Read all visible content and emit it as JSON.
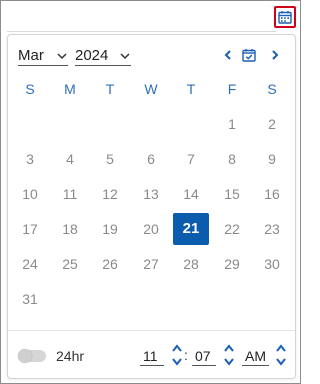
{
  "picker": {
    "month": "Mar",
    "year": "2024",
    "weekdays": [
      "S",
      "M",
      "T",
      "W",
      "T",
      "F",
      "S"
    ],
    "days": [
      [
        "",
        "",
        "",
        "",
        "",
        "1",
        "2"
      ],
      [
        "3",
        "4",
        "5",
        "6",
        "7",
        "8",
        "9"
      ],
      [
        "10",
        "11",
        "12",
        "13",
        "14",
        "15",
        "16"
      ],
      [
        "17",
        "18",
        "19",
        "20",
        "21",
        "22",
        "23"
      ],
      [
        "24",
        "25",
        "26",
        "27",
        "28",
        "29",
        "30"
      ],
      [
        "31",
        "",
        "",
        "",
        "",
        "",
        ""
      ]
    ],
    "selected_day": "21",
    "time": {
      "toggle_label": "24hr",
      "hour": "11",
      "separator": ":",
      "minute": "07",
      "meridiem": "AM"
    }
  },
  "colors": {
    "accent": "#0b5cad",
    "weekday": "#2f6fb8",
    "trigger_border": "#d0021b"
  },
  "icons": {
    "trigger": "calendar-icon",
    "prev": "chevron-left-icon",
    "today": "calendar-check-icon",
    "next": "chevron-right-icon"
  }
}
